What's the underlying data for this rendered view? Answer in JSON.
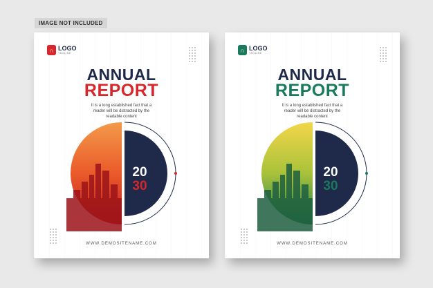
{
  "watermark_tag": "IMAGE NOT INCLUDED",
  "covers": [
    {
      "accent": "#d7262c",
      "logo_word": "LOGO",
      "logo_tagline": "TAGLINE",
      "title_line1": "ANNUAL",
      "title_line2": "REPORT",
      "description": "It is a long established fact that a\nreader will be distracted by the\nreadable content",
      "year_top": "20",
      "year_bottom": "30",
      "website": "WWW.DEMOSITENAME.COM"
    },
    {
      "accent": "#1a7a5c",
      "logo_word": "LOGO",
      "logo_tagline": "TAGLINE",
      "title_line1": "ANNUAL",
      "title_line2": "REPORT",
      "description": "It is a long established fact that a\nreader will be distracted by the\nreadable content",
      "year_top": "20",
      "year_bottom": "30",
      "website": "WWW.DEMOSITENAME.COM"
    }
  ]
}
